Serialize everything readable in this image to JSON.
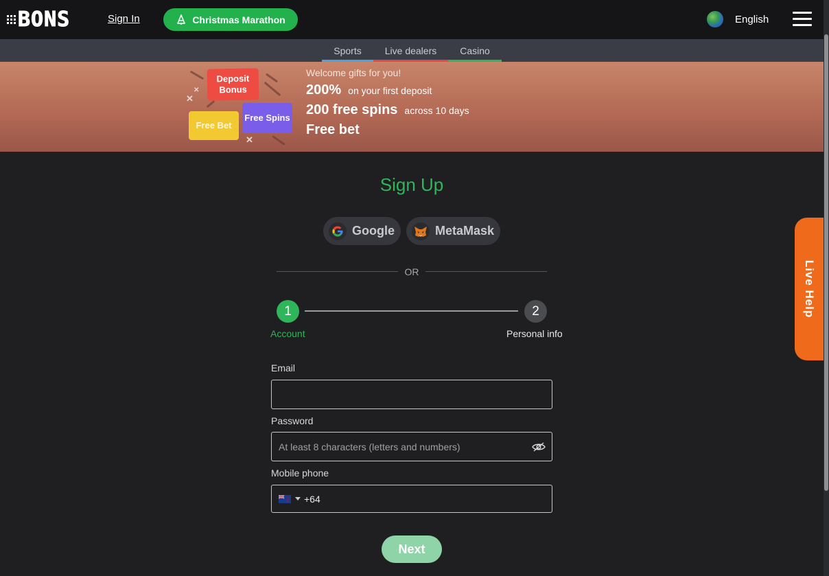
{
  "header": {
    "logo_text": "BONS",
    "signin_label": "Sign In",
    "promo_label": "Christmas Marathon",
    "language": "English"
  },
  "tabs": [
    {
      "label": "Sports",
      "color": "#4aa3e0"
    },
    {
      "label": "Live dealers",
      "color": "#e04a4a"
    },
    {
      "label": "Casino",
      "color": "#2fb55a"
    }
  ],
  "banner": {
    "welcome": "Welcome gifts for you!",
    "line1_big": "200%",
    "line1_small": "on your first deposit",
    "line2_big": "200 free spins",
    "line2_small": "across 10 days",
    "line3_big": "Free bet",
    "badge_deposit": "Deposit Bonus",
    "badge_freebet": "Free Bet",
    "badge_spins": "Free Spins"
  },
  "signup": {
    "title": "Sign Up",
    "google_label": "Google",
    "metamask_label": "MetaMask",
    "or_text": "OR",
    "steps": [
      {
        "number": "1",
        "label": "Account"
      },
      {
        "number": "2",
        "label": "Personal info"
      }
    ],
    "email_label": "Email",
    "email_value": "",
    "password_label": "Password",
    "password_placeholder": "At least 8 characters (letters and numbers)",
    "phone_label": "Mobile phone",
    "phone_code": "+64",
    "next_label": "Next"
  },
  "live_help_label": "Live Help",
  "colors": {
    "accent_green": "#2fb55a",
    "live_help_orange": "#f06a1c",
    "background": "#1f1f21"
  }
}
